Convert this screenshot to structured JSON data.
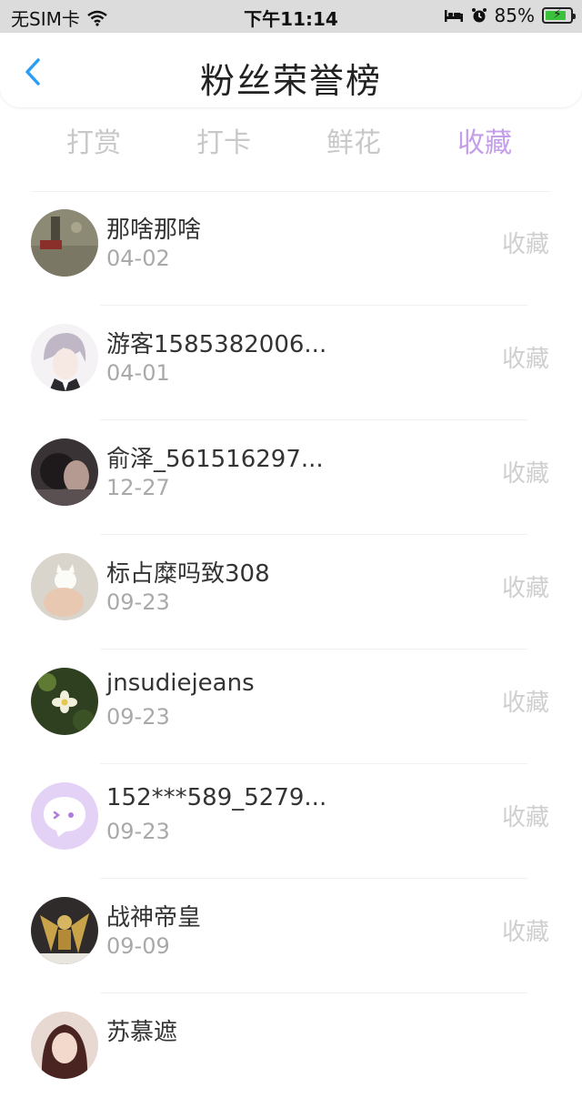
{
  "status_bar": {
    "carrier": "无SIM卡",
    "time": "下午11:14",
    "battery_percent": "85%",
    "battery_level": 0.85,
    "icons": [
      "wifi-icon",
      "bed-icon",
      "alarm-icon",
      "battery-charging-icon"
    ]
  },
  "header": {
    "title": "粉丝荣誉榜",
    "back_icon": "chevron-left-icon"
  },
  "tabs": [
    {
      "label": "打赏",
      "active": false
    },
    {
      "label": "打卡",
      "active": false
    },
    {
      "label": "鲜花",
      "active": false
    },
    {
      "label": "收藏",
      "active": true
    }
  ],
  "colors": {
    "accent": "#c49ee8",
    "back_arrow": "#2a9df4",
    "muted": "#a9a9a9"
  },
  "fans": [
    {
      "name": "那啥那啥",
      "date": "04-02",
      "action": "收藏",
      "avatar": "photo-avatar"
    },
    {
      "name": "游客1585382006...",
      "date": "04-01",
      "action": "收藏",
      "avatar": "anime-boy-avatar"
    },
    {
      "name": "俞泽_561516297...",
      "date": "12-27",
      "action": "收藏",
      "avatar": "dark-portrait-avatar"
    },
    {
      "name": "标占糜吗致308",
      "date": "09-23",
      "action": "收藏",
      "avatar": "cat-avatar"
    },
    {
      "name": "jnsudiejeans",
      "date": "09-23",
      "action": "收藏",
      "avatar": "flower-avatar"
    },
    {
      "name": "152***589_5279...",
      "date": "09-23",
      "action": "收藏",
      "avatar": "default-chat-avatar"
    },
    {
      "name": "战神帝皇",
      "date": "09-09",
      "action": "收藏",
      "avatar": "armor-avatar"
    },
    {
      "name": "苏慕遮",
      "date": "",
      "action": "",
      "avatar": "girl-avatar"
    }
  ]
}
